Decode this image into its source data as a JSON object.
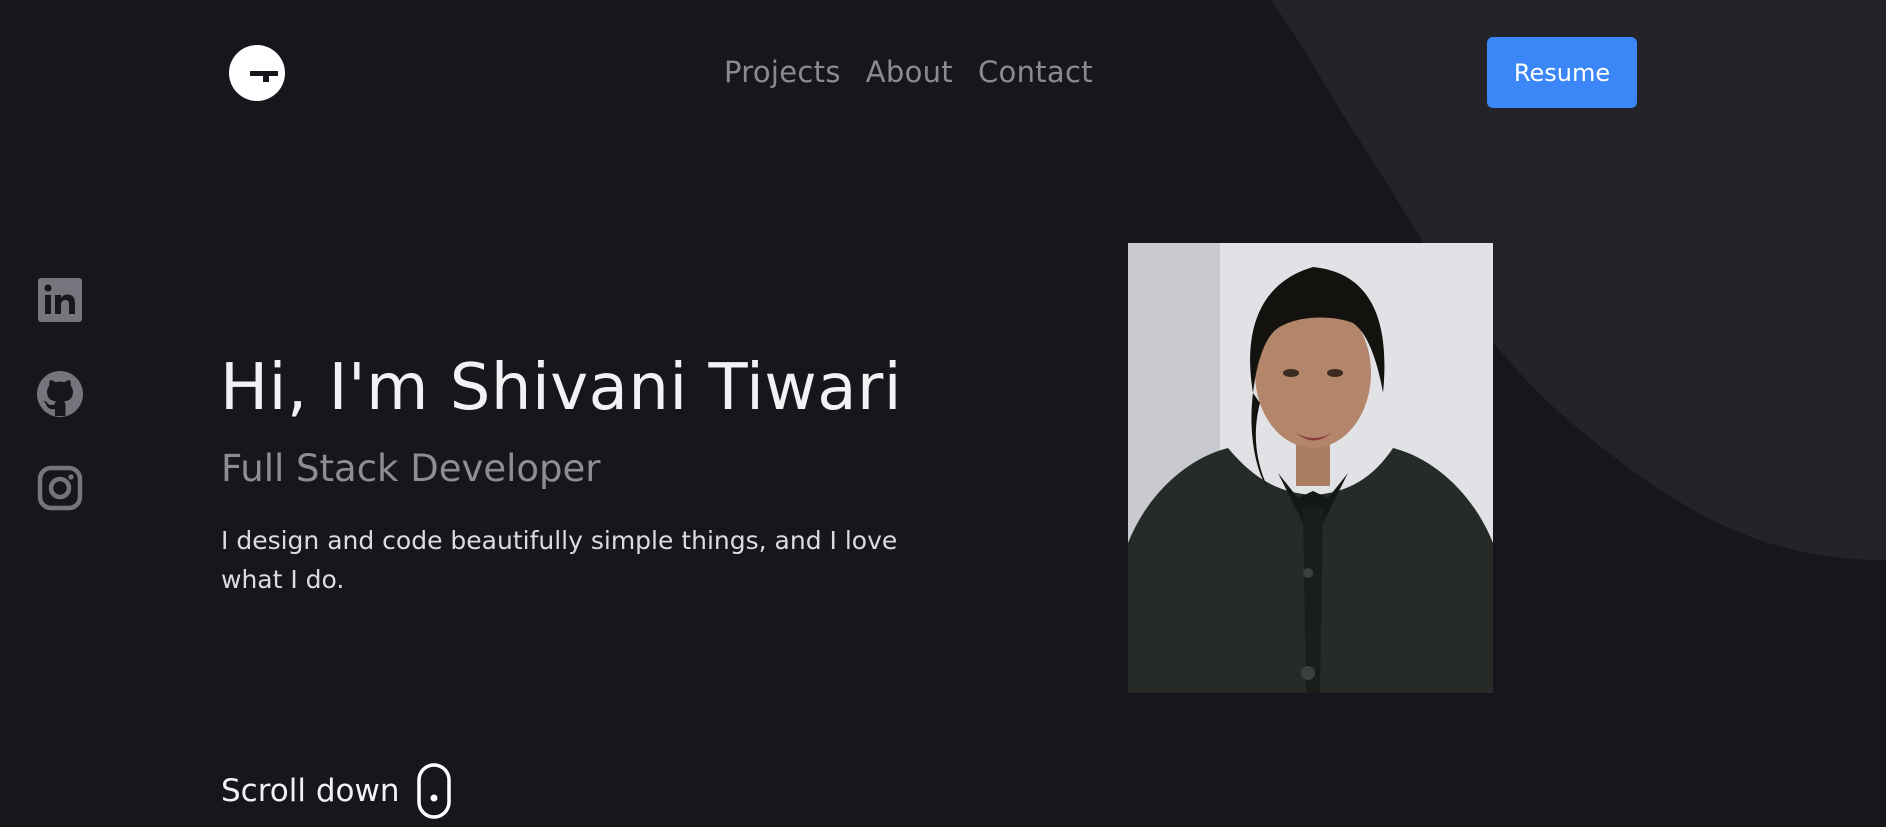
{
  "brand": {
    "logo_icon": "g-logo-icon"
  },
  "nav": {
    "items": [
      {
        "label": "Projects"
      },
      {
        "label": "About"
      },
      {
        "label": "Contact"
      }
    ]
  },
  "header": {
    "resume_label": "Resume"
  },
  "social": {
    "icons": [
      "linkedin-icon",
      "github-icon",
      "instagram-icon"
    ]
  },
  "hero": {
    "title": "Hi, I'm Shivani Tiwari",
    "subtitle": "Full Stack Developer",
    "description": "I design and code beautifully simple things, and I love what I do.",
    "scroll_label": "Scroll down",
    "scroll_icon": "mouse-icon"
  },
  "colors": {
    "background": "#17161c",
    "accent_shape": "#24232a",
    "button": "#3b87f7",
    "nav_text": "#8b8a92",
    "social_icon": "#76757d"
  }
}
